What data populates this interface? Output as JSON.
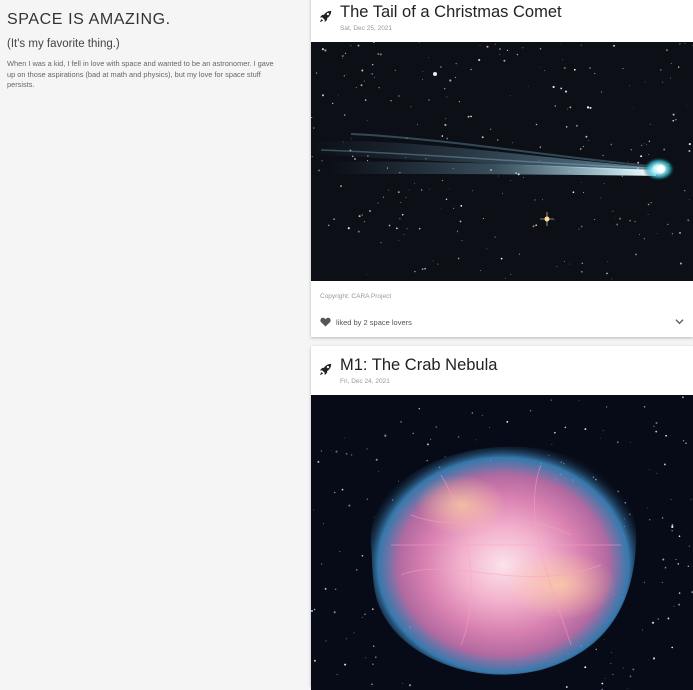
{
  "blog": {
    "title": "SPACE IS AMAZING.",
    "subtitle": "(It's my favorite thing.)",
    "description": "When I was a kid, I fell in love with space and wanted to be an astronomer. I gave up on those aspirations (bad at math and physics), but my love for space stuff persists."
  },
  "posts": [
    {
      "title": "The Tail of a Christmas Comet",
      "date": "Sat, Dec 25, 2021",
      "icon": "rocket-icon",
      "image": "comet-photo",
      "copyright": "Copyright: CARA Project",
      "likes_text": "liked by 2 space lovers"
    },
    {
      "title": "M1: The Crab Nebula",
      "date": "Fri, Dec 24, 2021",
      "icon": "rocket-icon",
      "image": "crab-nebula-photo"
    }
  ],
  "colors": {
    "page_bg": "#f5f5f5",
    "card_bg": "#ffffff",
    "comet_tail": "#9fd8e8",
    "nebula_core": "#f4b6cf",
    "nebula_edge": "#3a8fc8"
  }
}
